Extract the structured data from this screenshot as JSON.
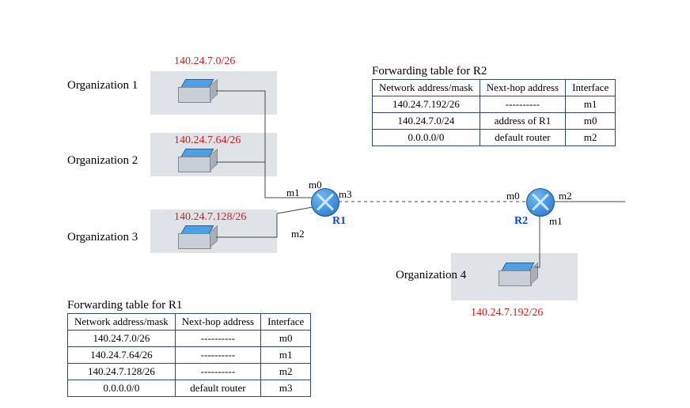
{
  "orgs": {
    "org1": {
      "label": "Organization 1",
      "net": "140.24.7.0/26"
    },
    "org2": {
      "label": "Organization 2",
      "net": "140.24.7.64/26"
    },
    "org3": {
      "label": "Organization 3",
      "net": "140.24.7.128/26"
    },
    "org4": {
      "label": "Organization 4",
      "net": "140.24.7.192/26"
    }
  },
  "routers": {
    "r1": {
      "name": "R1",
      "ports": {
        "p_m0": "m0",
        "p_m1": "m1",
        "p_m2": "m2",
        "p_m3": "m3"
      }
    },
    "r2": {
      "name": "R2",
      "ports": {
        "p_m0": "m0",
        "p_m1": "m1",
        "p_m2": "m2"
      }
    }
  },
  "table_r2": {
    "title": "Forwarding table for R2",
    "headers": {
      "c1": "Network address/mask",
      "c2": "Next-hop address",
      "c3": "Interface"
    },
    "rows": [
      {
        "c1": "140.24.7.192/26",
        "c2": "----------",
        "c3": "m1"
      },
      {
        "c1": "140.24.7.0/24",
        "c2": "address of R1",
        "c3": "m0"
      },
      {
        "c1": "0.0.0.0/0",
        "c2": "default router",
        "c3": "m2"
      }
    ]
  },
  "table_r1": {
    "title": "Forwarding table for R1",
    "headers": {
      "c1": "Network address/mask",
      "c2": "Next-hop address",
      "c3": "Interface"
    },
    "rows": [
      {
        "c1": "140.24.7.0/26",
        "c2": "----------",
        "c3": "m0"
      },
      {
        "c1": "140.24.7.64/26",
        "c2": "----------",
        "c3": "m1"
      },
      {
        "c1": "140.24.7.128/26",
        "c2": "----------",
        "c3": "m2"
      },
      {
        "c1": "0.0.0.0/0",
        "c2": "default router",
        "c3": "m3"
      }
    ]
  }
}
